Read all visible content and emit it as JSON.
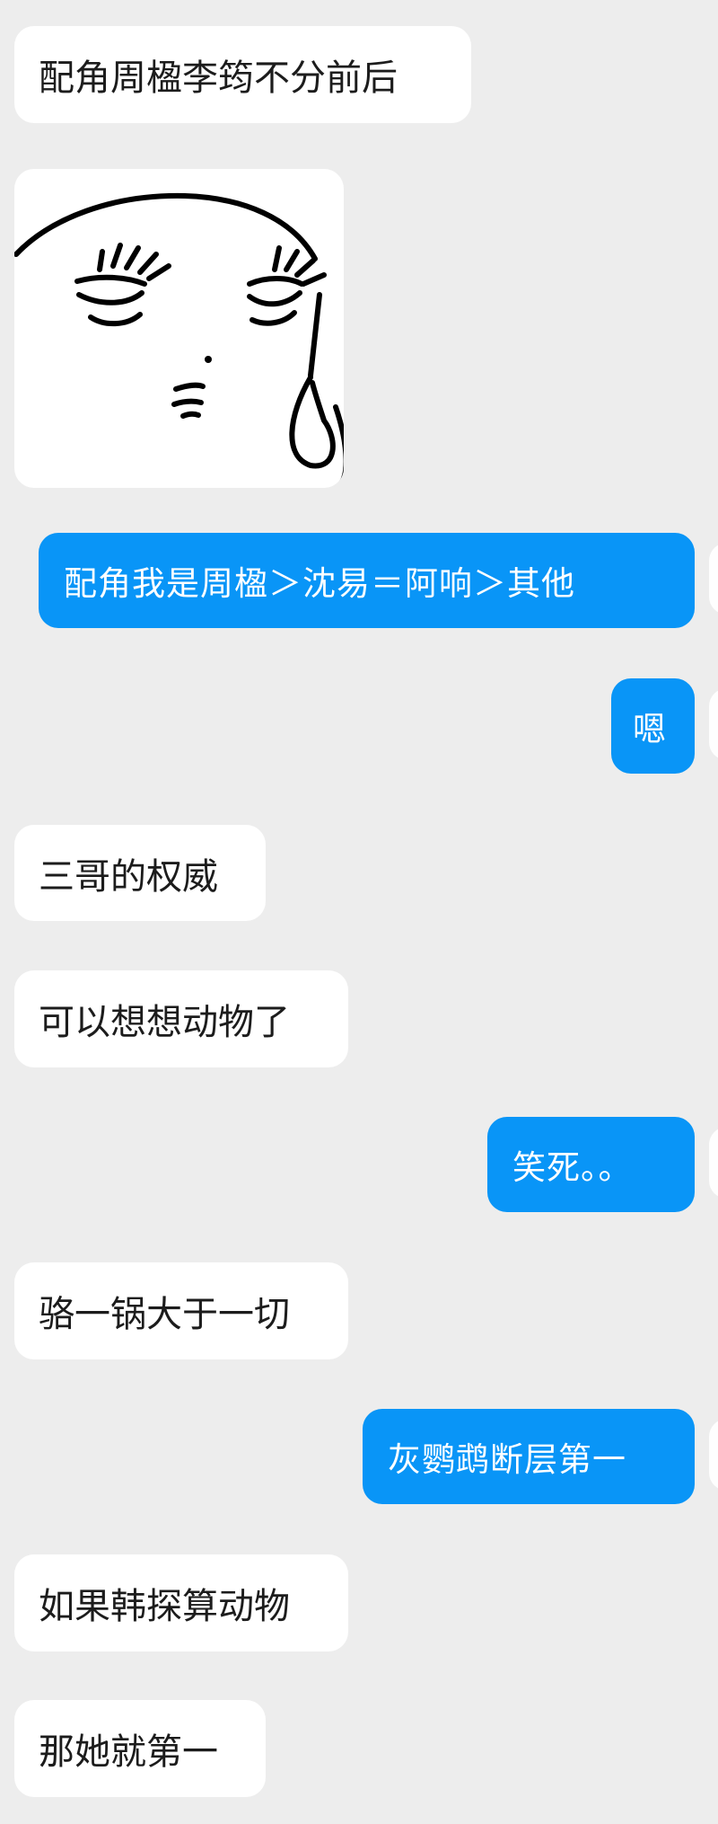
{
  "chat": {
    "messages": [
      {
        "side": "incoming",
        "type": "text",
        "text": "配角周楹李筠不分前后"
      },
      {
        "side": "incoming",
        "type": "sticker",
        "sticker": "crying-face-doodle"
      },
      {
        "side": "outgoing",
        "type": "text",
        "text": "配角我是周楹＞沈易＝阿响＞其他"
      },
      {
        "side": "outgoing",
        "type": "text",
        "text": "嗯"
      },
      {
        "side": "incoming",
        "type": "text",
        "text": "三哥的权威"
      },
      {
        "side": "incoming",
        "type": "text",
        "text": "可以想想动物了"
      },
      {
        "side": "outgoing",
        "type": "text",
        "text": "笑死。。"
      },
      {
        "side": "incoming",
        "type": "text",
        "text": "骆一锅大于一切"
      },
      {
        "side": "outgoing",
        "type": "text",
        "text": "灰鹦鹉断层第一"
      },
      {
        "side": "incoming",
        "type": "text",
        "text": "如果韩探算动物"
      },
      {
        "side": "incoming",
        "type": "text",
        "text": "那她就第一"
      }
    ]
  },
  "colors": {
    "background": "#ededed",
    "incoming_bubble": "#ffffff",
    "outgoing_bubble": "#0995f7",
    "incoming_text": "#1c1c1c",
    "outgoing_text": "#ffffff"
  }
}
